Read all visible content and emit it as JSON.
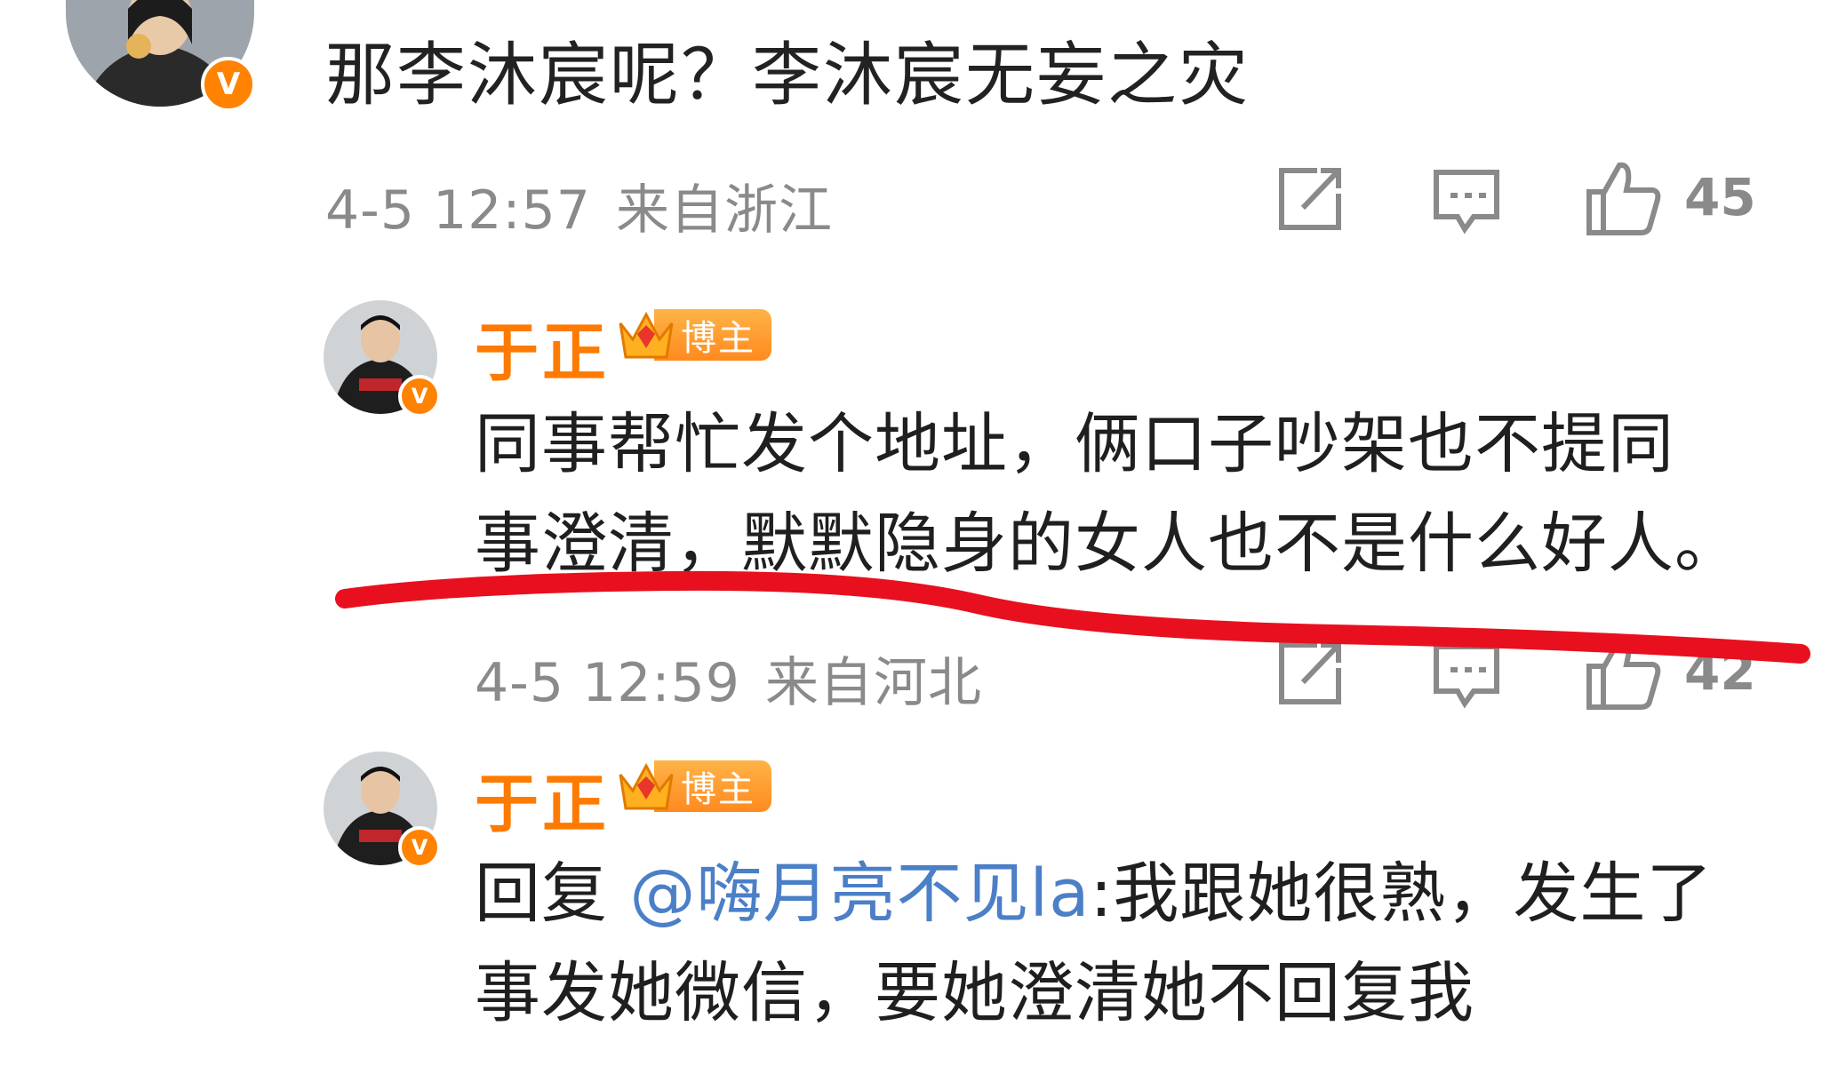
{
  "top_comment": {
    "text": "那李沐宸呢？李沐宸无妄之灾",
    "time": "4-5 12:57",
    "location": "来自浙江",
    "likes": "45"
  },
  "replies": [
    {
      "username": "于正",
      "badge_label": "博主",
      "text_line1": "同事帮忙发个地址，俩口子吵架也不提同",
      "text_line2": "事澄清，默默隐身的女人也不是什么好人。",
      "time": "4-5 12:59",
      "location": "来自河北",
      "likes": "42"
    },
    {
      "username": "于正",
      "badge_label": "博主",
      "reply_prefix": "回复 ",
      "mention": "@嗨月亮不见la",
      "text_line1_rest": ":我跟她很熟，发生了",
      "text_line2": "事发她微信，要她澄清她不回复我"
    }
  ],
  "icons": {
    "verified": "V",
    "share": "share-icon",
    "comment": "comment-icon",
    "like": "thumbs-up-icon"
  },
  "colors": {
    "username": "#ff7a00",
    "mention": "#4b7fc7",
    "meta": "#8a8a8a",
    "highlight_stroke": "#e8101e"
  }
}
